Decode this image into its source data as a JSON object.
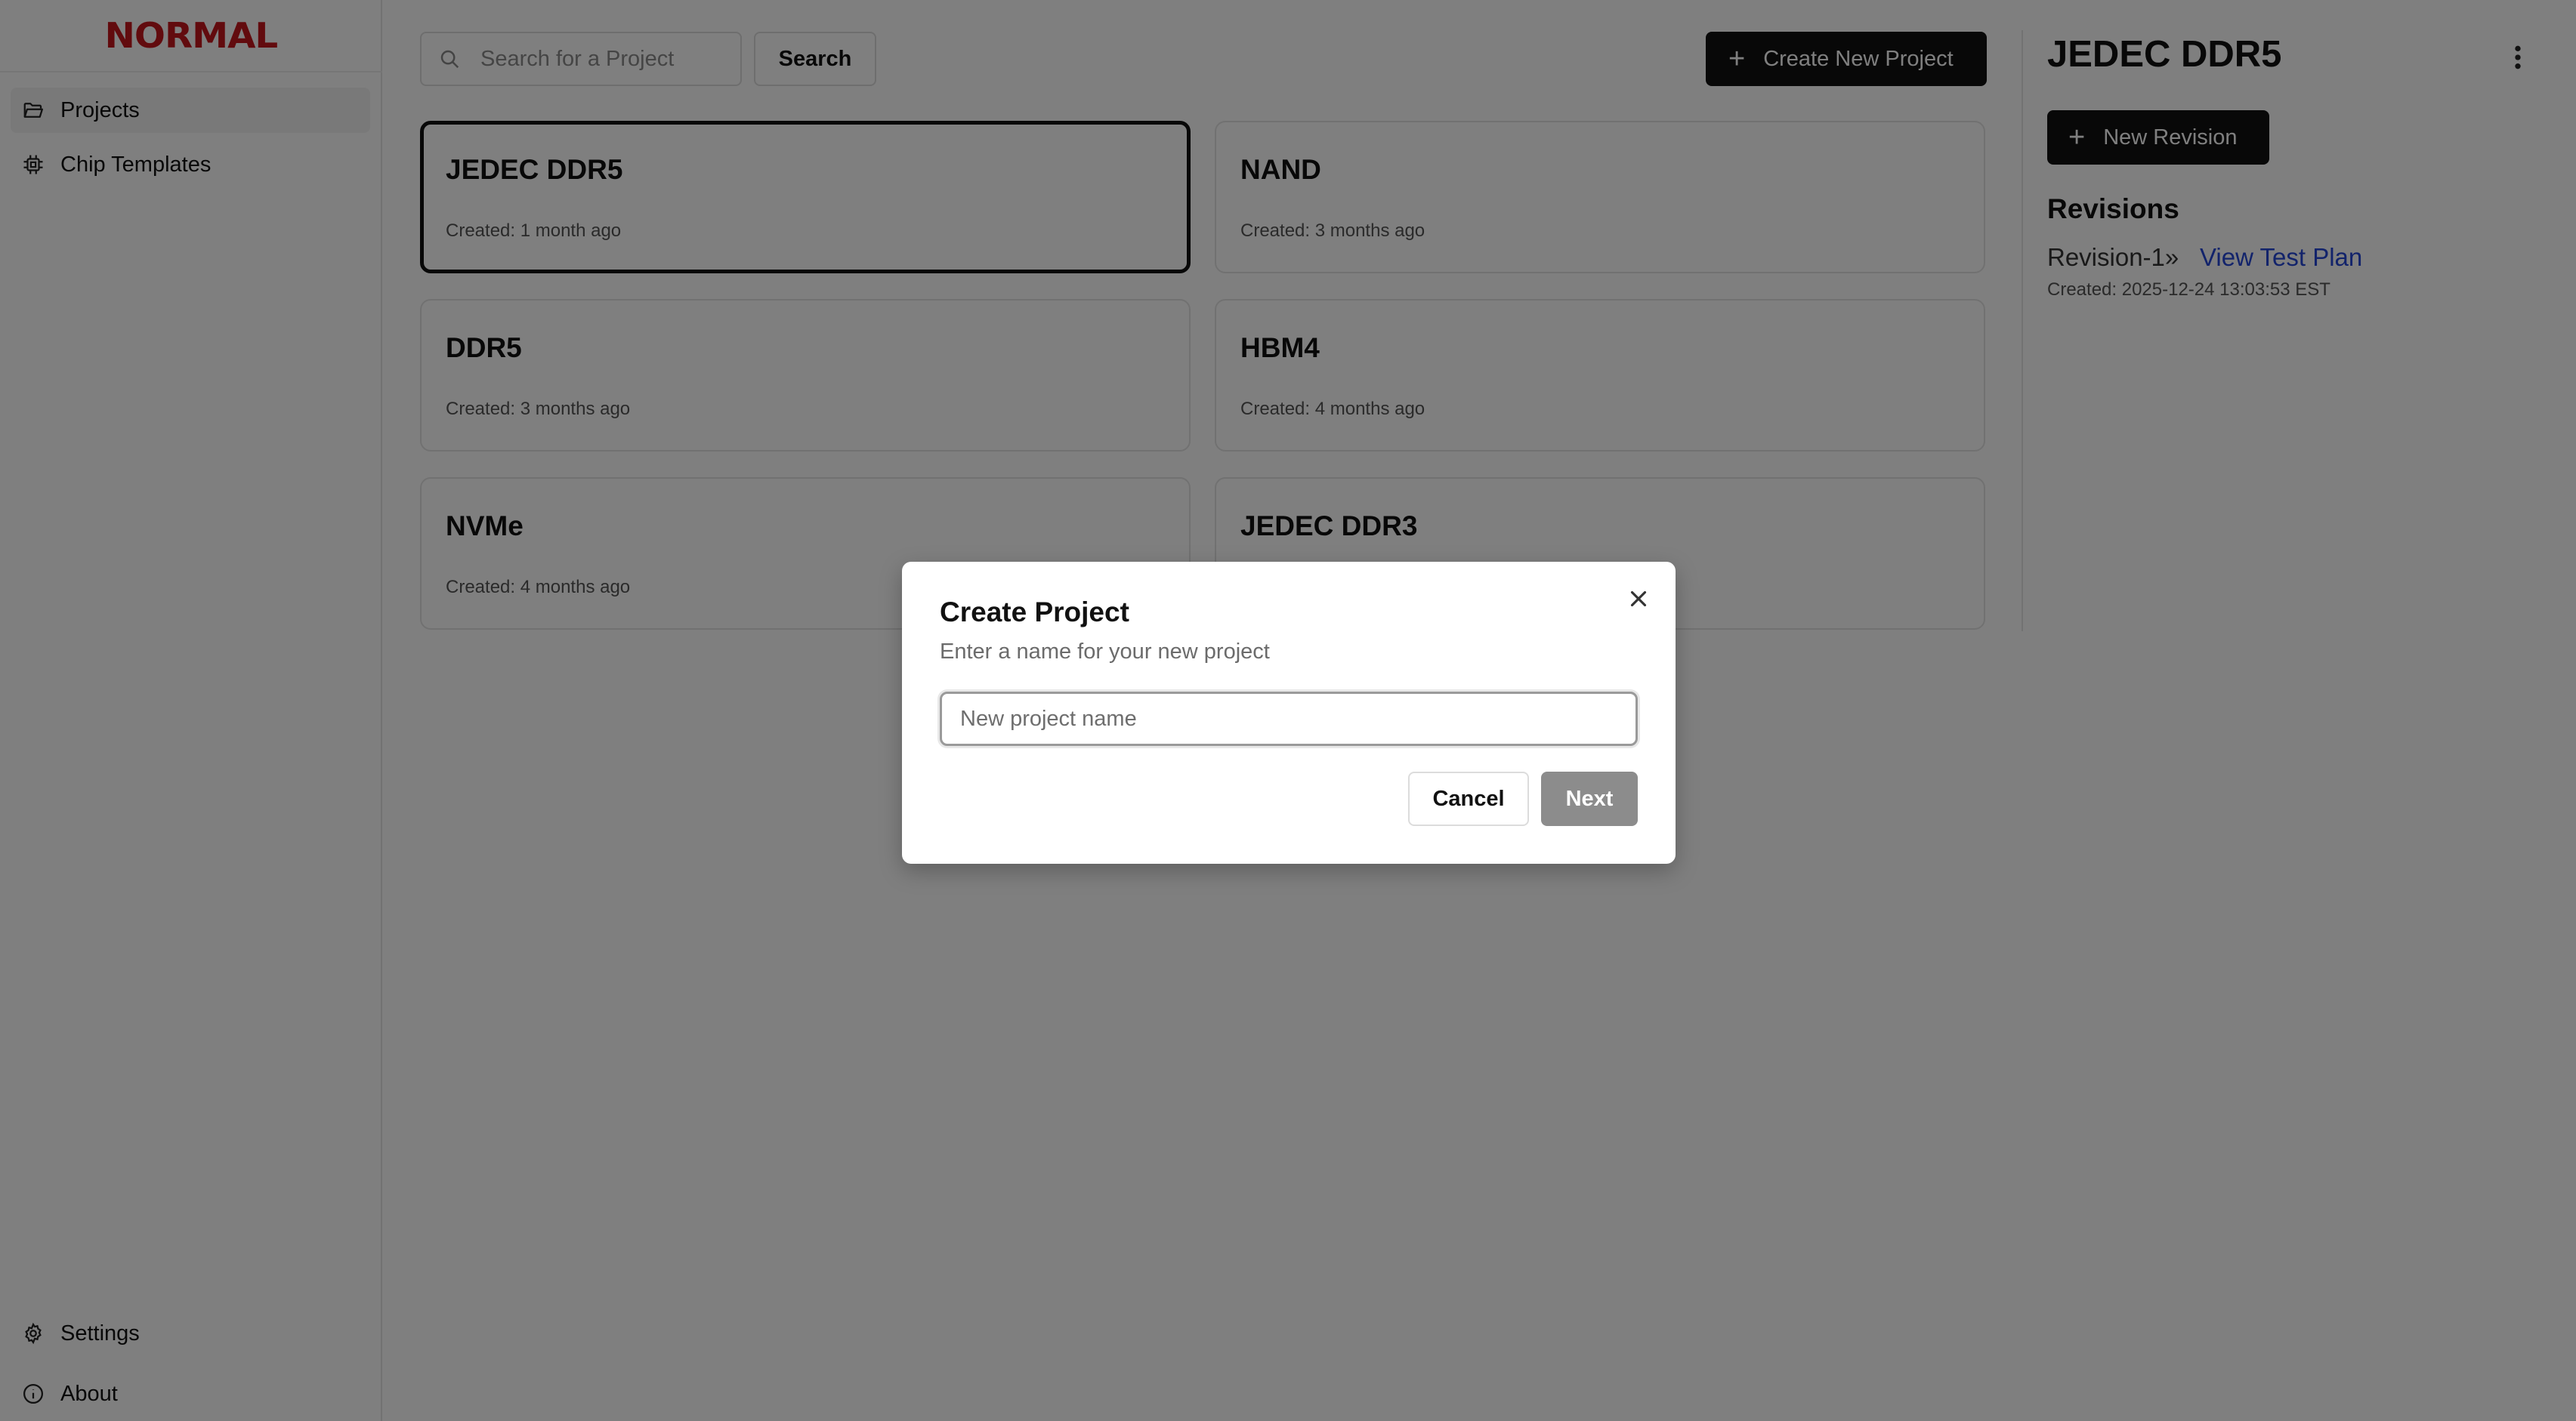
{
  "brand": {
    "logo_text": "NORMAL",
    "accent": "#c4161c"
  },
  "sidebar": {
    "items": [
      {
        "label": "Projects",
        "icon": "folder-icon",
        "active": true
      },
      {
        "label": "Chip Templates",
        "icon": "chip-icon",
        "active": false
      }
    ],
    "footer": [
      {
        "label": "Settings",
        "icon": "gear-icon"
      },
      {
        "label": "About",
        "icon": "info-icon"
      }
    ]
  },
  "toolbar": {
    "search_placeholder": "Search for a Project",
    "search_button": "Search",
    "create_button": "Create New Project"
  },
  "projects": [
    {
      "name": "JEDEC DDR5",
      "created": "Created: 1 month ago",
      "selected": true
    },
    {
      "name": "NAND",
      "created": "Created: 3 months ago",
      "selected": false
    },
    {
      "name": "DDR5",
      "created": "Created: 3 months ago",
      "selected": false
    },
    {
      "name": "HBM4",
      "created": "Created: 4 months ago",
      "selected": false
    },
    {
      "name": "NVMe",
      "created": "Created: 4 months ago",
      "selected": false
    },
    {
      "name": "JEDEC DDR3",
      "created": "",
      "selected": false
    }
  ],
  "detail": {
    "title": "JEDEC DDR5",
    "new_revision_button": "New Revision",
    "revisions_heading": "Revisions",
    "revisions": [
      {
        "name": "Revision-1»",
        "link": "View Test Plan",
        "created": "Created: 2025-12-24 13:03:53 EST"
      }
    ]
  },
  "modal": {
    "title": "Create Project",
    "subtitle": "Enter a name for your new project",
    "input_placeholder": "New project name",
    "input_value": "",
    "cancel_label": "Cancel",
    "next_label": "Next"
  }
}
